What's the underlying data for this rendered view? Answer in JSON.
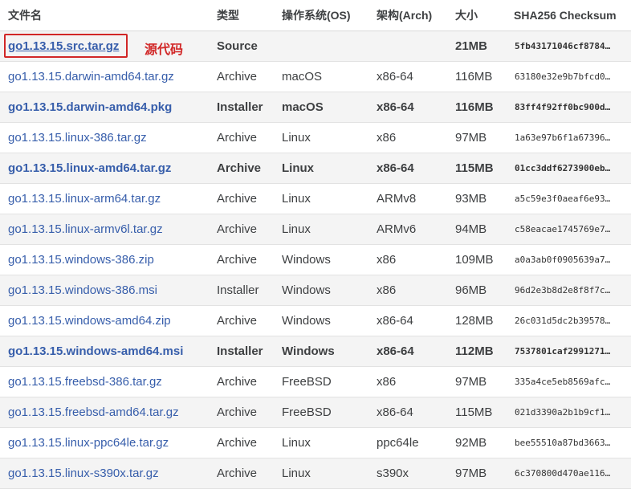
{
  "headers": [
    "文件名",
    "类型",
    "操作系统(OS)",
    "架构(Arch)",
    "大小",
    "SHA256 Checksum"
  ],
  "annotation": "源代码",
  "rows": [
    {
      "file": "go1.13.15.src.tar.gz",
      "kind": "Source",
      "os": "",
      "arch": "",
      "size": "21MB",
      "sha": "5fb43171046cf8784…",
      "highlight": true
    },
    {
      "file": "go1.13.15.darwin-amd64.tar.gz",
      "kind": "Archive",
      "os": "macOS",
      "arch": "x86-64",
      "size": "116MB",
      "sha": "63180e32e9b7bfcd0…",
      "highlight": false
    },
    {
      "file": "go1.13.15.darwin-amd64.pkg",
      "kind": "Installer",
      "os": "macOS",
      "arch": "x86-64",
      "size": "116MB",
      "sha": "83ff4f92ff0bc900d…",
      "highlight": true
    },
    {
      "file": "go1.13.15.linux-386.tar.gz",
      "kind": "Archive",
      "os": "Linux",
      "arch": "x86",
      "size": "97MB",
      "sha": "1a63e97b6f1a67396…",
      "highlight": false
    },
    {
      "file": "go1.13.15.linux-amd64.tar.gz",
      "kind": "Archive",
      "os": "Linux",
      "arch": "x86-64",
      "size": "115MB",
      "sha": "01cc3ddf6273900eb…",
      "highlight": true
    },
    {
      "file": "go1.13.15.linux-arm64.tar.gz",
      "kind": "Archive",
      "os": "Linux",
      "arch": "ARMv8",
      "size": "93MB",
      "sha": "a5c59e3f0aeaf6e93…",
      "highlight": false
    },
    {
      "file": "go1.13.15.linux-armv6l.tar.gz",
      "kind": "Archive",
      "os": "Linux",
      "arch": "ARMv6",
      "size": "94MB",
      "sha": "c58eacae1745769e7…",
      "highlight": false
    },
    {
      "file": "go1.13.15.windows-386.zip",
      "kind": "Archive",
      "os": "Windows",
      "arch": "x86",
      "size": "109MB",
      "sha": "a0a3ab0f0905639a7…",
      "highlight": false
    },
    {
      "file": "go1.13.15.windows-386.msi",
      "kind": "Installer",
      "os": "Windows",
      "arch": "x86",
      "size": "96MB",
      "sha": "96d2e3b8d2e8f8f7c…",
      "highlight": false
    },
    {
      "file": "go1.13.15.windows-amd64.zip",
      "kind": "Archive",
      "os": "Windows",
      "arch": "x86-64",
      "size": "128MB",
      "sha": "26c031d5dc2b39578…",
      "highlight": false
    },
    {
      "file": "go1.13.15.windows-amd64.msi",
      "kind": "Installer",
      "os": "Windows",
      "arch": "x86-64",
      "size": "112MB",
      "sha": "7537801caf2991271…",
      "highlight": true
    },
    {
      "file": "go1.13.15.freebsd-386.tar.gz",
      "kind": "Archive",
      "os": "FreeBSD",
      "arch": "x86",
      "size": "97MB",
      "sha": "335a4ce5eb8569afc…",
      "highlight": false
    },
    {
      "file": "go1.13.15.freebsd-amd64.tar.gz",
      "kind": "Archive",
      "os": "FreeBSD",
      "arch": "x86-64",
      "size": "115MB",
      "sha": "021d3390a2b1b9cf1…",
      "highlight": false
    },
    {
      "file": "go1.13.15.linux-ppc64le.tar.gz",
      "kind": "Archive",
      "os": "Linux",
      "arch": "ppc64le",
      "size": "92MB",
      "sha": "bee55510a87bd3663…",
      "highlight": false
    },
    {
      "file": "go1.13.15.linux-s390x.tar.gz",
      "kind": "Archive",
      "os": "Linux",
      "arch": "s390x",
      "size": "97MB",
      "sha": "6c370800d470ae116…",
      "highlight": false
    }
  ],
  "colors": {
    "link": "#375eab",
    "annotation": "#d12727",
    "stripe": "#f4f4f4"
  }
}
